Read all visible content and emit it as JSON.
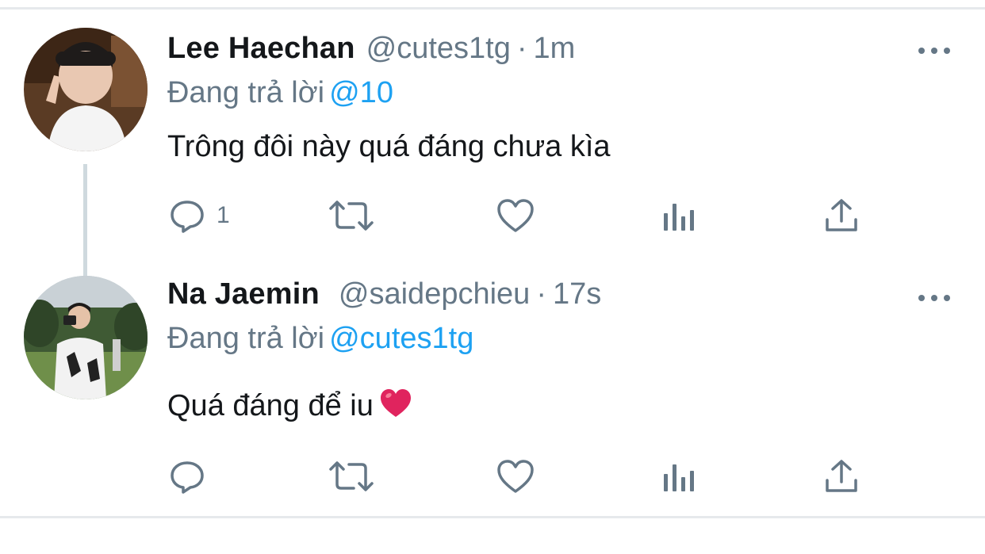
{
  "tweets": [
    {
      "name": "Lee Haechan",
      "handle": "@cutes1tg",
      "separator": "·",
      "time": "1m",
      "reply_prefix": "Đang trả lời",
      "reply_to": "@10",
      "text": "Trông đôi này quá đáng chưa kìa",
      "reply_count": "1"
    },
    {
      "name": "Na Jaemin",
      "handle": "@saidepchieu",
      "separator": "·",
      "time": "17s",
      "reply_prefix": "Đang trả lời",
      "reply_to": "@cutes1tg",
      "text": "Quá đáng để iu",
      "emoji": "red-heart-emoji",
      "reply_count": ""
    }
  ],
  "icons": {
    "reply": "comment-bubble-icon",
    "retweet": "retweet-icon",
    "like": "heart-outline-icon",
    "stats": "bar-chart-icon",
    "share": "share-icon",
    "more": "more-options-icon"
  },
  "colors": {
    "text": "#14171a",
    "secondary": "#657786",
    "link": "#1da1f2",
    "divider": "#e6e9ec",
    "heart": "#e0245e"
  }
}
